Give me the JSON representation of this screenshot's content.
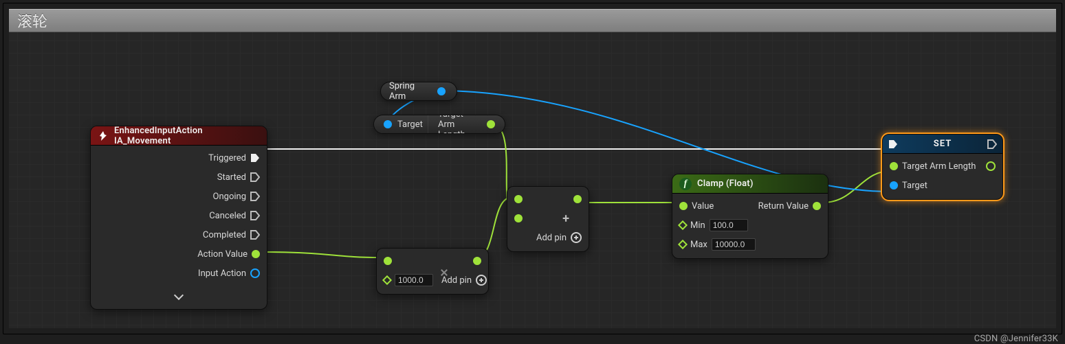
{
  "comment_title": "滚轮",
  "event_node": {
    "title": "EnhancedInputAction IA_Movement",
    "rows": [
      "Triggered",
      "Started",
      "Ongoing",
      "Canceled",
      "Completed",
      "Action Value",
      "Input Action"
    ]
  },
  "spring_arm_pill": "Spring Arm",
  "getter_pill": {
    "in": "Target",
    "out": "Target Arm Length"
  },
  "multiply": {
    "add_pin": "Add pin",
    "default": "1000.0"
  },
  "add": {
    "add_pin": "Add pin"
  },
  "clamp": {
    "title": "Clamp (Float)",
    "value": "Value",
    "min_label": "Min",
    "min": "100.0",
    "max_label": "Max",
    "max": "10000.0",
    "ret": "Return Value"
  },
  "set": {
    "title": "SET",
    "prop": "Target Arm Length",
    "target": "Target"
  },
  "watermark": "CSDN @Jennifer33K",
  "chart_data": null
}
